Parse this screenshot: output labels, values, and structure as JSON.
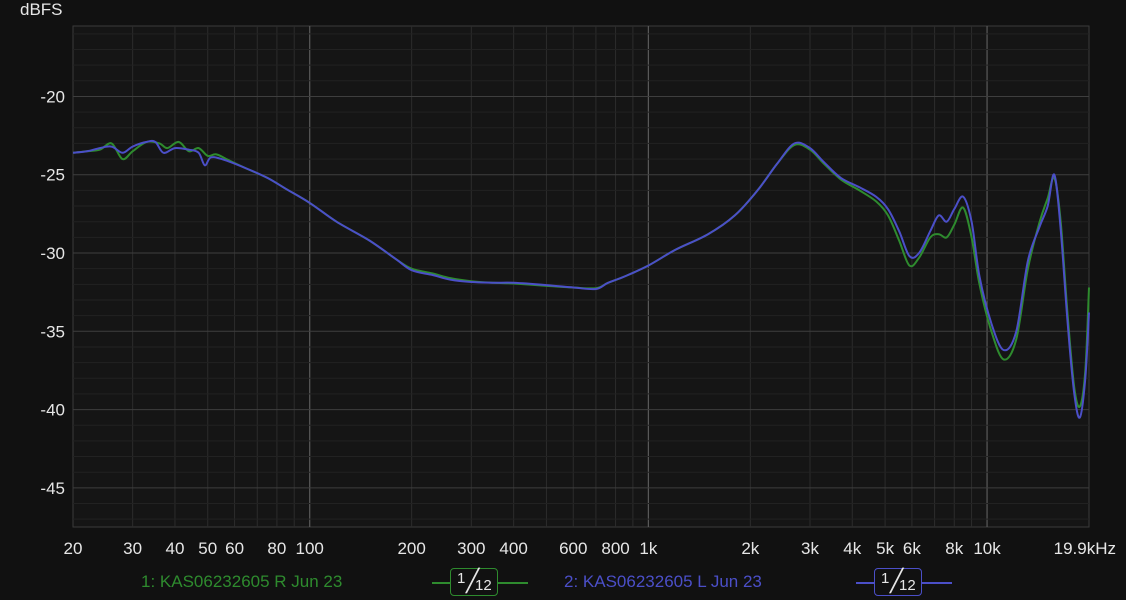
{
  "chart_data": {
    "type": "line",
    "ylabel": "dBFS",
    "xunit_label": "Hz",
    "xscale": "log",
    "xlim": [
      20,
      20000
    ],
    "ylim": [
      -47.5,
      -15.5
    ],
    "yticks": [
      -20,
      -25,
      -30,
      -35,
      -40,
      -45
    ],
    "ytick_labels": [
      "-20",
      "-25",
      "-30",
      "-35",
      "-40",
      "-45"
    ],
    "xticks": [
      20,
      30,
      40,
      50,
      60,
      80,
      100,
      200,
      300,
      400,
      600,
      800,
      1000,
      2000,
      3000,
      4000,
      5000,
      6000,
      8000,
      10000,
      19900
    ],
    "xtick_labels": [
      "20",
      "30",
      "40",
      "50",
      "60",
      "80",
      "100",
      "200",
      "300",
      "400",
      "600",
      "800",
      "1k",
      "2k",
      "3k",
      "4k",
      "5k",
      "6k",
      "8k",
      "10k",
      "19.9kHz"
    ],
    "grid": true,
    "series": [
      {
        "name": "1: KAS06232605 R Jun 23",
        "color": "#2e8b2e",
        "points": [
          [
            20,
            -23.6
          ],
          [
            22,
            -23.5
          ],
          [
            24,
            -23.4
          ],
          [
            26,
            -23.0
          ],
          [
            28,
            -24.0
          ],
          [
            30,
            -23.5
          ],
          [
            33,
            -22.9
          ],
          [
            36,
            -23.0
          ],
          [
            38,
            -23.3
          ],
          [
            41,
            -22.9
          ],
          [
            44,
            -23.5
          ],
          [
            47,
            -23.3
          ],
          [
            50,
            -23.8
          ],
          [
            53,
            -23.7
          ],
          [
            58,
            -24.1
          ],
          [
            65,
            -24.6
          ],
          [
            75,
            -25.2
          ],
          [
            85,
            -25.9
          ],
          [
            100,
            -26.8
          ],
          [
            120,
            -28.0
          ],
          [
            150,
            -29.2
          ],
          [
            180,
            -30.4
          ],
          [
            200,
            -31.0
          ],
          [
            230,
            -31.3
          ],
          [
            260,
            -31.6
          ],
          [
            300,
            -31.8
          ],
          [
            350,
            -31.9
          ],
          [
            400,
            -31.95
          ],
          [
            500,
            -32.1
          ],
          [
            600,
            -32.2
          ],
          [
            700,
            -32.25
          ],
          [
            760,
            -31.9
          ],
          [
            850,
            -31.5
          ],
          [
            1000,
            -30.8
          ],
          [
            1200,
            -29.8
          ],
          [
            1500,
            -28.8
          ],
          [
            1800,
            -27.6
          ],
          [
            2100,
            -26.0
          ],
          [
            2400,
            -24.3
          ],
          [
            2700,
            -23.1
          ],
          [
            3000,
            -23.4
          ],
          [
            3300,
            -24.3
          ],
          [
            3700,
            -25.3
          ],
          [
            4200,
            -26.0
          ],
          [
            4700,
            -26.7
          ],
          [
            5100,
            -27.6
          ],
          [
            5500,
            -29.2
          ],
          [
            5900,
            -30.8
          ],
          [
            6300,
            -30.3
          ],
          [
            6800,
            -29.0
          ],
          [
            7200,
            -28.8
          ],
          [
            7600,
            -29.0
          ],
          [
            8000,
            -28.2
          ],
          [
            8500,
            -27.1
          ],
          [
            9000,
            -29.0
          ],
          [
            9500,
            -32.0
          ],
          [
            10300,
            -35.0
          ],
          [
            11200,
            -36.8
          ],
          [
            12200,
            -35.5
          ],
          [
            13200,
            -31.0
          ],
          [
            14300,
            -28.0
          ],
          [
            15100,
            -26.5
          ],
          [
            15800,
            -25.2
          ],
          [
            16500,
            -28.0
          ],
          [
            17300,
            -34.0
          ],
          [
            18100,
            -38.6
          ],
          [
            18800,
            -39.8
          ],
          [
            19500,
            -37.5
          ],
          [
            20000,
            -32.2
          ]
        ]
      },
      {
        "name": "2: KAS06232605 L Jun 23",
        "color": "#4b4fc8",
        "points": [
          [
            20,
            -23.6
          ],
          [
            22,
            -23.5
          ],
          [
            24,
            -23.3
          ],
          [
            26,
            -23.2
          ],
          [
            28,
            -23.6
          ],
          [
            30,
            -23.2
          ],
          [
            33,
            -22.9
          ],
          [
            35,
            -22.9
          ],
          [
            37,
            -23.6
          ],
          [
            40,
            -23.3
          ],
          [
            44,
            -23.4
          ],
          [
            47,
            -23.6
          ],
          [
            49,
            -24.4
          ],
          [
            51,
            -23.9
          ],
          [
            55,
            -24.0
          ],
          [
            65,
            -24.6
          ],
          [
            75,
            -25.2
          ],
          [
            85,
            -25.9
          ],
          [
            100,
            -26.8
          ],
          [
            120,
            -28.0
          ],
          [
            150,
            -29.2
          ],
          [
            180,
            -30.4
          ],
          [
            200,
            -31.1
          ],
          [
            230,
            -31.4
          ],
          [
            260,
            -31.7
          ],
          [
            300,
            -31.85
          ],
          [
            350,
            -31.9
          ],
          [
            400,
            -31.9
          ],
          [
            500,
            -32.05
          ],
          [
            600,
            -32.2
          ],
          [
            700,
            -32.3
          ],
          [
            760,
            -31.9
          ],
          [
            850,
            -31.5
          ],
          [
            1000,
            -30.8
          ],
          [
            1200,
            -29.8
          ],
          [
            1500,
            -28.8
          ],
          [
            1800,
            -27.6
          ],
          [
            2100,
            -26.0
          ],
          [
            2400,
            -24.3
          ],
          [
            2700,
            -23.0
          ],
          [
            3000,
            -23.3
          ],
          [
            3300,
            -24.2
          ],
          [
            3700,
            -25.2
          ],
          [
            4200,
            -25.8
          ],
          [
            4700,
            -26.4
          ],
          [
            5100,
            -27.2
          ],
          [
            5500,
            -28.6
          ],
          [
            5900,
            -30.2
          ],
          [
            6300,
            -30.0
          ],
          [
            6800,
            -28.6
          ],
          [
            7200,
            -27.6
          ],
          [
            7600,
            -28.0
          ],
          [
            8000,
            -27.2
          ],
          [
            8500,
            -26.4
          ],
          [
            9000,
            -28.0
          ],
          [
            9500,
            -31.5
          ],
          [
            10300,
            -34.5
          ],
          [
            11200,
            -36.2
          ],
          [
            12200,
            -35.0
          ],
          [
            13200,
            -30.5
          ],
          [
            14300,
            -28.3
          ],
          [
            15100,
            -27.0
          ],
          [
            15800,
            -25.0
          ],
          [
            16500,
            -28.5
          ],
          [
            17300,
            -34.5
          ],
          [
            18100,
            -39.0
          ],
          [
            18800,
            -40.5
          ],
          [
            19500,
            -38.0
          ],
          [
            20000,
            -33.8
          ]
        ]
      }
    ]
  },
  "legend": {
    "series1_label": "1: KAS06232605 R Jun 23",
    "series2_label": "2: KAS06232605 L Jun 23",
    "smoothing_num": "1",
    "smoothing_den": "12"
  }
}
